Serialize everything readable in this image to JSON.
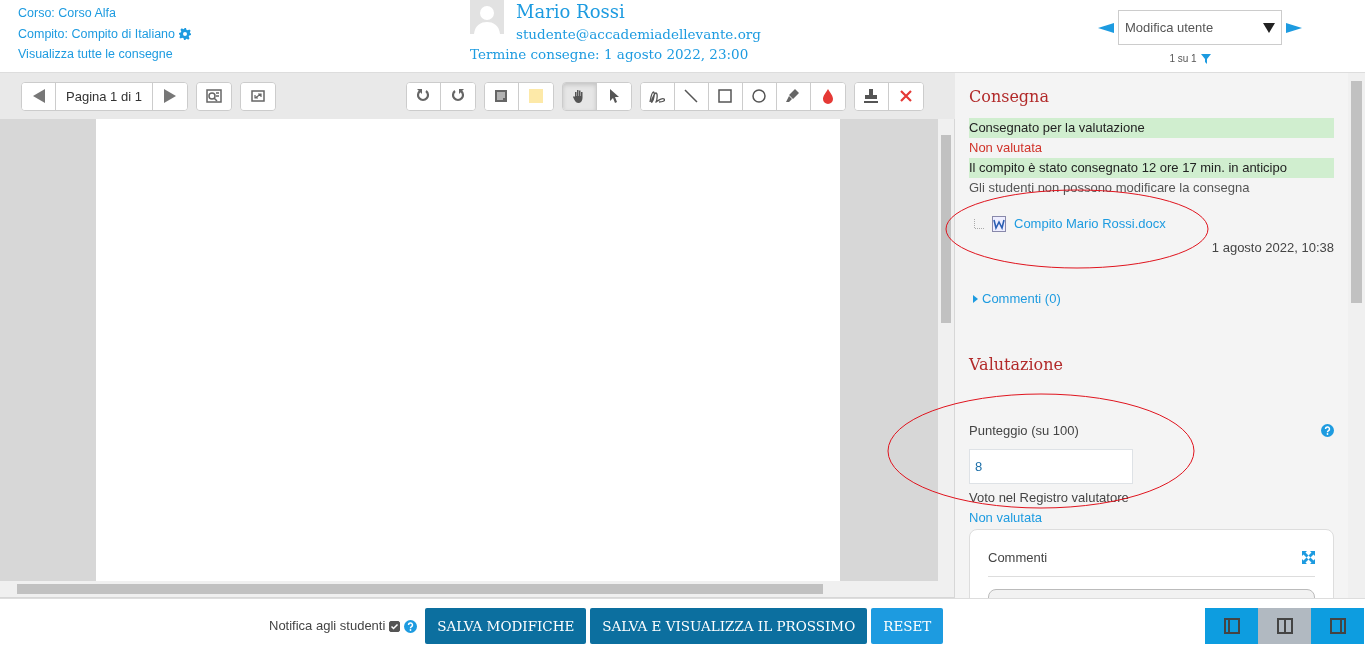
{
  "header": {
    "course_link": "Corso: Corso Alfa",
    "assignment_link": "Compito: Compito di Italiano",
    "all_submissions_link": "Visualizza tutte le consegne",
    "user_name": "Mario Rossi",
    "user_email": "studente@accademiadellevante.org",
    "due_date": "Termine consegne: 1 agosto 2022, 23:00",
    "user_select": {
      "value": "Modifica utente"
    },
    "user_count": "1 su 1"
  },
  "toolbar": {
    "page_label": "Pagina 1 di 1",
    "groups": [
      [
        {
          "kind": "rotate-left",
          "selected": false
        },
        {
          "kind": "rotate-right",
          "selected": false
        }
      ],
      [
        {
          "kind": "comment",
          "selected": false
        },
        {
          "kind": "color",
          "selected": false
        }
      ],
      [
        {
          "kind": "hand",
          "selected": true
        },
        {
          "kind": "pointer",
          "selected": false
        }
      ],
      [
        {
          "kind": "pen",
          "selected": false
        },
        {
          "kind": "line",
          "selected": false
        },
        {
          "kind": "rectangle",
          "selected": false
        },
        {
          "kind": "oval",
          "selected": false
        },
        {
          "kind": "highlighter",
          "selected": false
        },
        {
          "kind": "drop",
          "selected": false
        }
      ],
      [
        {
          "kind": "stamp",
          "selected": false
        },
        {
          "kind": "delete",
          "selected": false
        }
      ]
    ]
  },
  "submission": {
    "title": "Consegna",
    "statuses": [
      {
        "text": "Consegnato per la valutazione",
        "kind": "success"
      },
      {
        "text": "Non valutata",
        "kind": "danger"
      },
      {
        "text": "Il compito è stato consegnato 12 ore 17 min. in anticipo",
        "kind": "success"
      },
      {
        "text": "Gli studenti non possono modificare la consegna",
        "kind": "plain"
      }
    ],
    "file": {
      "name": "Compito Mario Rossi.docx",
      "date": "1 agosto 2022, 10:38",
      "circled": true
    },
    "comments_link": "Commenti (0)"
  },
  "grade": {
    "title": "Valutazione",
    "score_label": "Punteggio (su 100)",
    "score_value": "8",
    "circled": true,
    "gradebook_label": "Voto nel Registro valutatore",
    "gradebook_value": "Non valutata",
    "feedback_title": "Commenti"
  },
  "footer": {
    "notify_label": "Notifica agli studenti",
    "notify_checked": true,
    "buttons": [
      {
        "label": "SALVA MODIFICHE",
        "kind": "dark"
      },
      {
        "label": "SALVA E VISUALIZZA IL PROSSIMO",
        "kind": "dark"
      },
      {
        "label": "RESET",
        "kind": "light"
      }
    ],
    "layouts": [
      {
        "kind": "left",
        "selected": false
      },
      {
        "kind": "both",
        "selected": true
      },
      {
        "kind": "right",
        "selected": false
      }
    ]
  }
}
